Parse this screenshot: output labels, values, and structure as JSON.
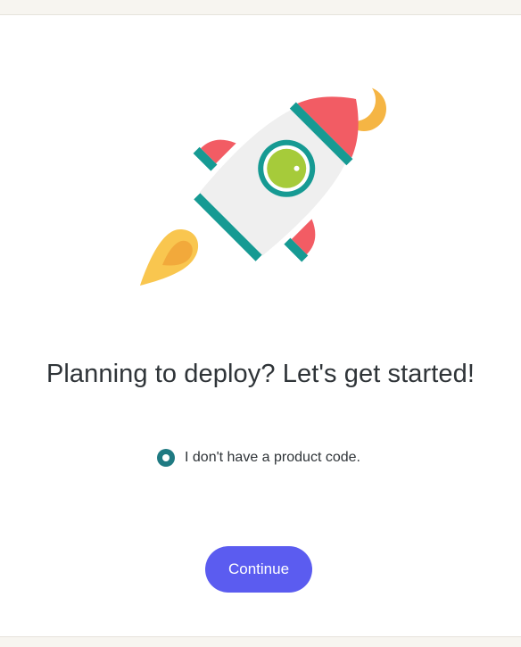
{
  "headline": "Planning to deploy? Let's get started!",
  "option": {
    "label": "I don't have a product code.",
    "selected": true
  },
  "continue_label": "Continue",
  "illustration": {
    "icon": "rocket-illustration",
    "colors": {
      "body": "#efefef",
      "accent_red": "#f25c64",
      "accent_teal": "#169a93",
      "window_green": "#a6cb3a",
      "moon": "#f5b544",
      "flame": "#f9c64f"
    }
  },
  "colors": {
    "button": "#5b5cf0",
    "radio": "#1f7a82",
    "text": "#2f3438"
  }
}
